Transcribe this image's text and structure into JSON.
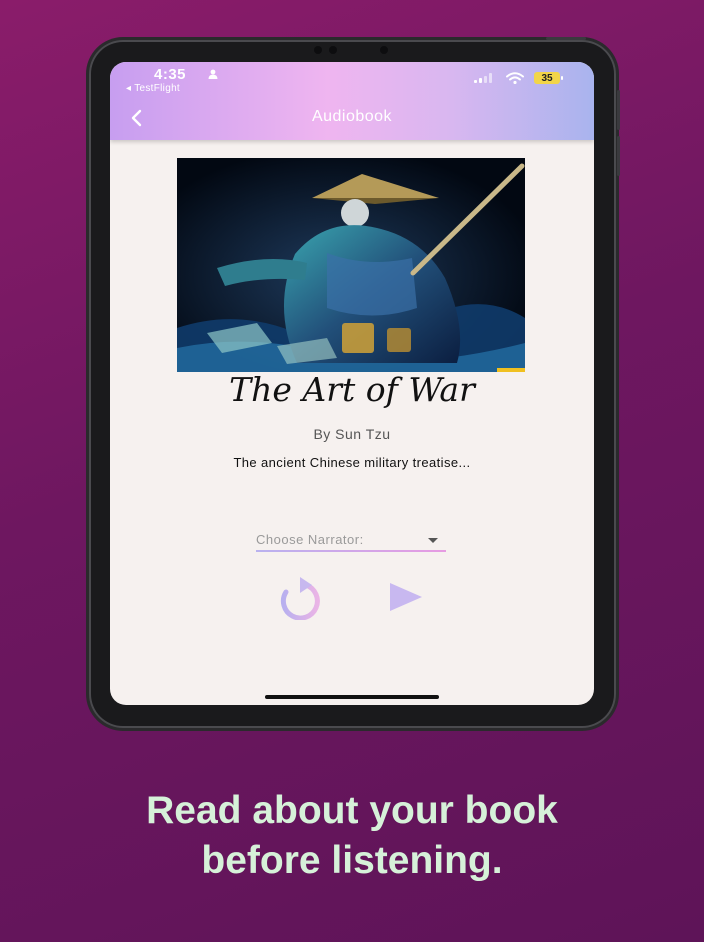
{
  "status_bar": {
    "time": "4:35",
    "back_app": "◂ TestFlight",
    "battery": "35"
  },
  "nav": {
    "title": "Audiobook",
    "back_icon": "chevron-left-icon"
  },
  "book": {
    "title": "The Art of War",
    "author": "By Sun Tzu",
    "description": "The ancient Chinese military treatise..."
  },
  "player": {
    "narrator_placeholder": "Choose Narrator:",
    "replay_icon": "replay-icon",
    "play_icon": "play-icon"
  },
  "caption": {
    "line1": "Read about your book",
    "line2": "before listening."
  },
  "colors": {
    "background": "#6e1760",
    "caption_text": "#d6f1d9",
    "topbar_start": "#c79ef0",
    "topbar_end": "#a9b4ee",
    "screen_bg": "#f6f1ef",
    "accent_purple": "#c8a9ee",
    "accent_pink": "#e79be2"
  }
}
